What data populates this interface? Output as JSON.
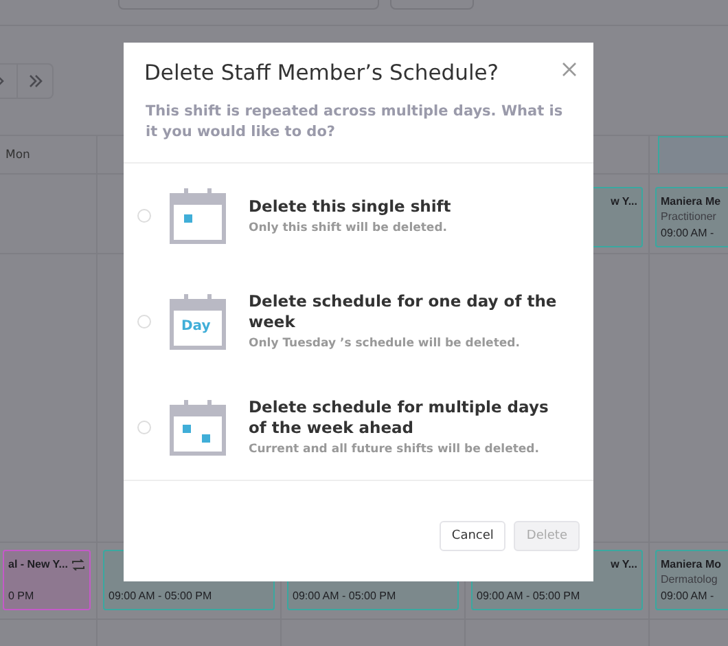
{
  "background": {
    "day_header": "Mon",
    "cards_top": [
      {
        "title": "w Y...",
        "color": "#3aa8a0",
        "repeat": false
      },
      {
        "title": "Maniera Me",
        "subtitle": "Practitioner",
        "time": "09:00 AM -",
        "color": "#3aa8a0",
        "repeat": false
      }
    ],
    "cards_bottom": [
      {
        "title": "al - New Y...",
        "time": "0 PM",
        "color": "#c45ac8",
        "repeat": true
      },
      {
        "time": "09:00 AM - 05:00 PM",
        "color": "#3aa8a0",
        "repeat": false
      },
      {
        "time": "09:00 AM - 05:00 PM",
        "color": "#3aa8a0",
        "repeat": false
      },
      {
        "title": "w Y...",
        "time": "09:00 AM - 05:00 PM",
        "color": "#3aa8a0",
        "repeat": false
      },
      {
        "title": "Maniera Mo",
        "subtitle": "Dermatolog",
        "time": "09:00 AM -",
        "color": "#3aa8a0",
        "repeat": false
      }
    ]
  },
  "dialog": {
    "title": "Delete Staff Member’s Schedule?",
    "description": "This shift is repeated across multiple days. What is it you would like to do?",
    "options": [
      {
        "kind": "single",
        "title": "Delete this single shift",
        "note": "Only this shift will be deleted.",
        "selected": false
      },
      {
        "kind": "day",
        "icon_text": "Day",
        "title": "Delete schedule for one day of the week",
        "note": "Only Tuesday ’s schedule will be deleted.",
        "selected": false
      },
      {
        "kind": "multiple",
        "title": "Delete schedule for multiple days of the week ahead",
        "note": "Current and all future shifts will be deleted.",
        "selected": false
      }
    ],
    "buttons": [
      {
        "label": "Cancel",
        "disabled": false
      },
      {
        "label": "Delete",
        "disabled": true
      }
    ]
  }
}
